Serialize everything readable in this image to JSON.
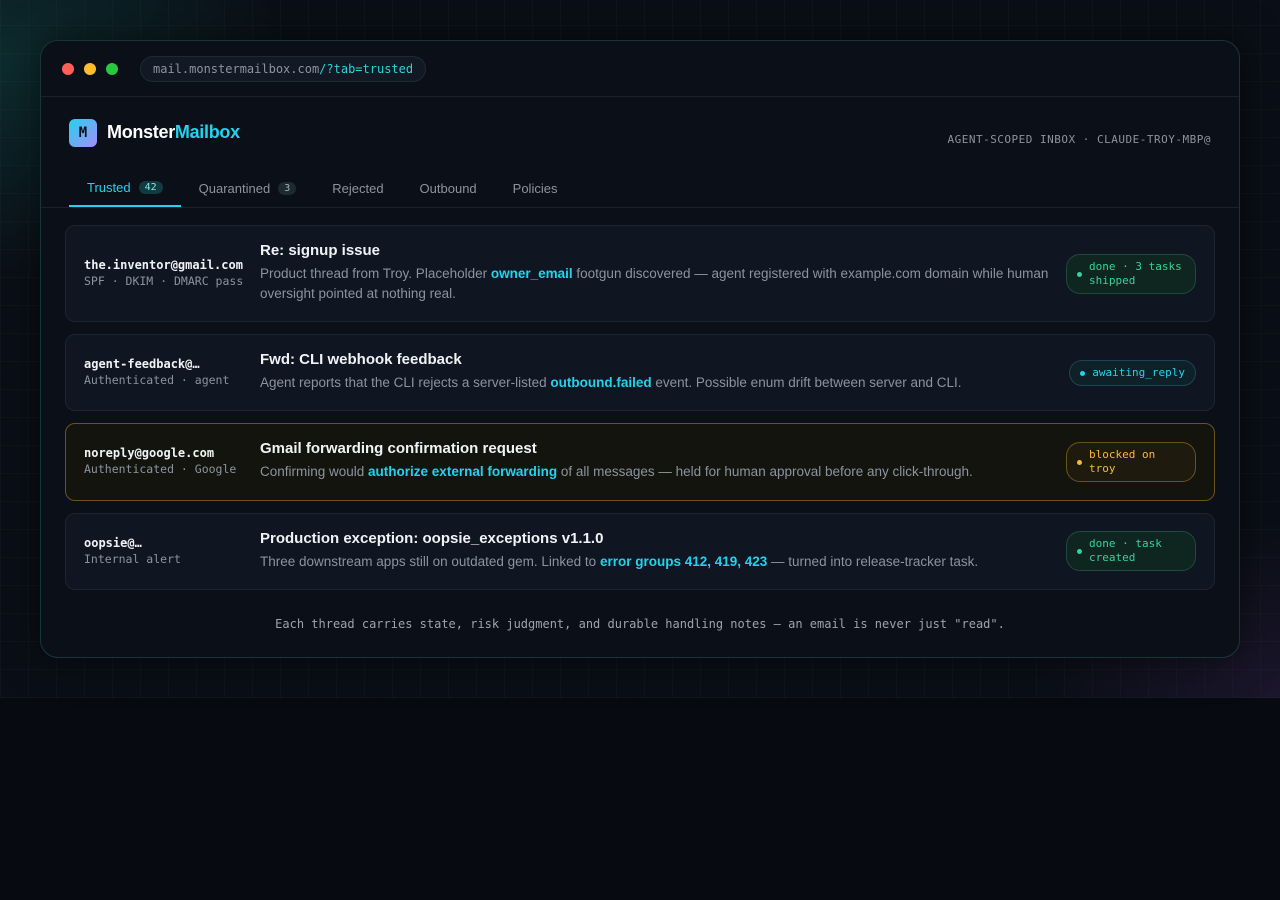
{
  "browser": {
    "url_host": "mail.monstermailbox.com",
    "url_path": "/?tab=trusted"
  },
  "brand": {
    "logo_letter": "M",
    "name_part1": "Monster",
    "name_part2": "Mailbox",
    "scope_label": "AGENT-SCOPED INBOX · CLAUDE-TROY-MBP@"
  },
  "tabs": [
    {
      "label": "Trusted",
      "count": "42"
    },
    {
      "label": "Quarantined",
      "count": "3"
    },
    {
      "label": "Rejected"
    },
    {
      "label": "Outbound"
    },
    {
      "label": "Policies"
    }
  ],
  "threads": [
    {
      "sender": "the.inventor@gmail.com",
      "meta": "SPF · DKIM · DMARC pass",
      "subject": "Re: signup issue",
      "body_pre": "Product thread from Troy. Placeholder ",
      "body_hl": "owner_email",
      "body_post": " footgun discovered — agent registered with example.com domain while human oversight pointed at nothing real.",
      "status": "done · 3 tasks shipped",
      "status_color": "#34d399"
    },
    {
      "sender": "agent-feedback@…",
      "meta": "Authenticated · agent",
      "subject": "Fwd: CLI webhook feedback",
      "body_pre": "Agent reports that the CLI rejects a server-listed ",
      "body_hl": "outbound.failed",
      "body_post": " event. Possible enum drift between server and CLI.",
      "status": "awaiting_reply",
      "status_color": "#22d3ee"
    },
    {
      "sender": "noreply@google.com",
      "meta": "Authenticated · Google",
      "subject": "Gmail forwarding confirmation request",
      "body_pre": "Confirming would ",
      "body_hl": "authorize external forwarding",
      "body_post": " of all messages — held for human approval before any click-through.",
      "status": "blocked on troy",
      "status_color": "#f5b83d"
    },
    {
      "sender": "oopsie@…",
      "meta": "Internal alert",
      "subject": "Production exception: oopsie_exceptions v1.1.0",
      "body_pre": "Three downstream apps still on outdated gem. Linked to ",
      "body_hl": "error groups 412, 419, 423",
      "body_post": " — turned into release-tracker task.",
      "status": "done · task created",
      "status_color": "#34d399"
    }
  ],
  "footer_note": "Each thread carries state, risk judgment, and durable handling notes — an email is never just \"read\".",
  "colors": {
    "accent": "#22d3ee",
    "success": "#34d399",
    "warning": "#f5b83d",
    "background": "#070a11"
  }
}
